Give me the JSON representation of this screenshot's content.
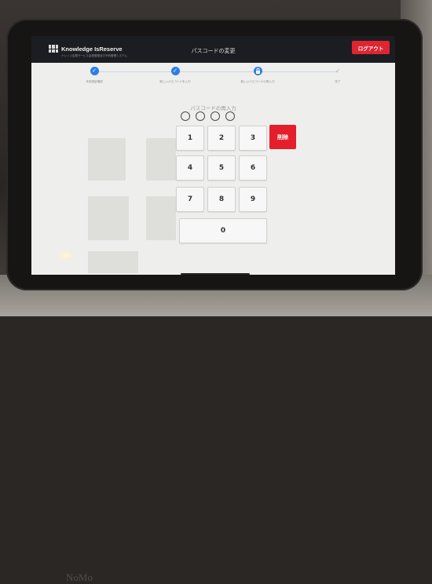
{
  "header": {
    "logo_title": "Knowledge IsReserve",
    "logo_subtitle": "ナレッジ会員サービス会員登録及び予約管理システム",
    "title": "パスコードの変更",
    "logout_label": "ログアウト"
  },
  "steps": [
    {
      "label": "本体認証確認",
      "state": "done",
      "icon": "check-icon"
    },
    {
      "label": "新しいパスコードを入力",
      "state": "done",
      "icon": "check-icon"
    },
    {
      "label": "新しいパスコードの再入力",
      "state": "current",
      "icon": "lock-icon"
    },
    {
      "label": "完了",
      "state": "pending",
      "icon": "check-icon"
    }
  ],
  "pin": {
    "prompt": "パスコードの再入力",
    "length": 4,
    "filled": 0
  },
  "keypad": {
    "keys": [
      "1",
      "2",
      "3",
      "4",
      "5",
      "6",
      "7",
      "8",
      "9",
      "0"
    ],
    "delete_label": "削除"
  },
  "kiosk": {
    "label": "NoMo"
  },
  "colors": {
    "header_bg": "#1c1d22",
    "accent_red": "#e02530",
    "step_blue": "#2c7ee8",
    "screen_bg": "#eeeeec"
  }
}
